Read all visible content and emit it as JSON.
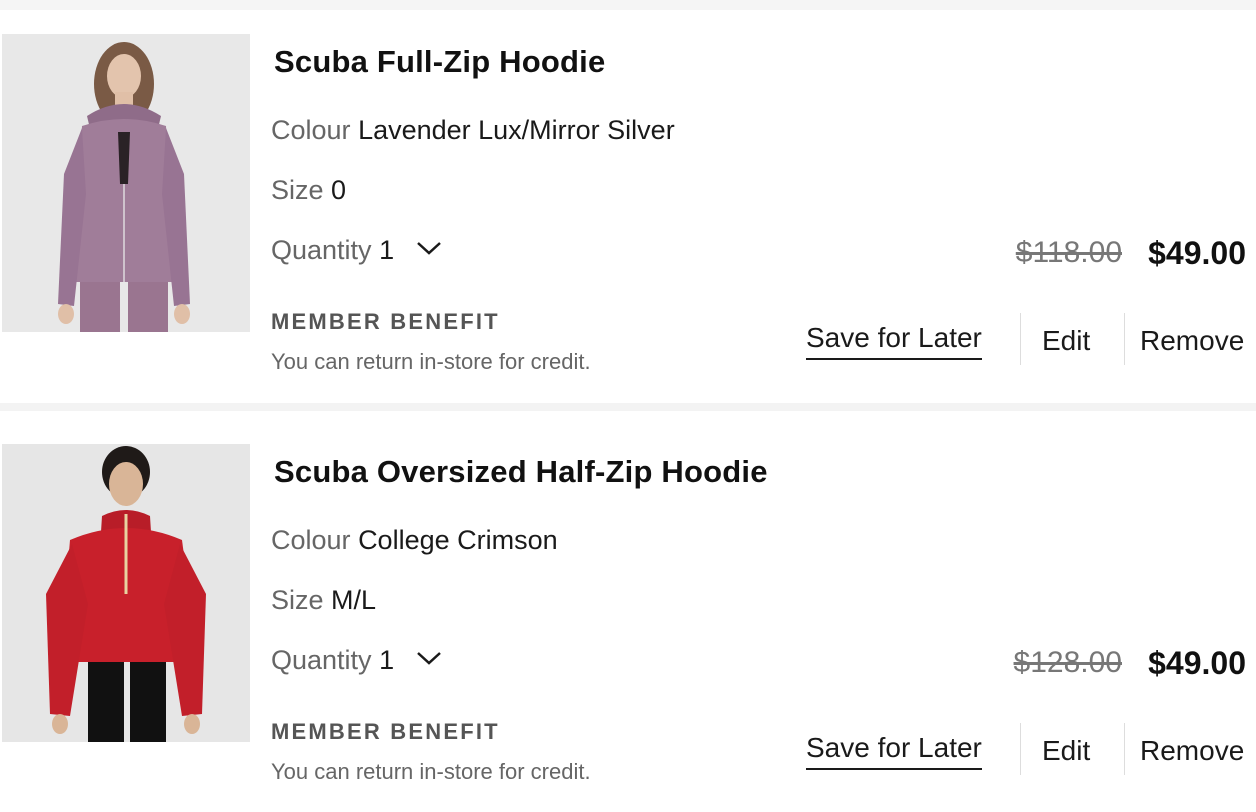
{
  "cart": {
    "items": [
      {
        "name": "Scuba Full-Zip Hoodie",
        "colour_label": "Colour",
        "colour_value": "Lavender Lux/Mirror Silver",
        "size_label": "Size",
        "size_value": "0",
        "quantity_label": "Quantity",
        "quantity_value": "1",
        "original_price": "$118.00",
        "sale_price": "$49.00",
        "benefit_title": "MEMBER BENEFIT",
        "benefit_text": "You can return in-store for credit.",
        "actions": {
          "save": "Save for Later",
          "edit": "Edit",
          "remove": "Remove"
        },
        "image_color": "#a07d99"
      },
      {
        "name": "Scuba Oversized Half-Zip Hoodie",
        "colour_label": "Colour",
        "colour_value": "College Crimson",
        "size_label": "Size",
        "size_value": "M/L",
        "quantity_label": "Quantity",
        "quantity_value": "1",
        "original_price": "$128.00",
        "sale_price": "$49.00",
        "benefit_title": "MEMBER BENEFIT",
        "benefit_text": "You can return in-store for credit.",
        "actions": {
          "save": "Save for Later",
          "edit": "Edit",
          "remove": "Remove"
        },
        "image_color": "#c8202b"
      }
    ]
  }
}
